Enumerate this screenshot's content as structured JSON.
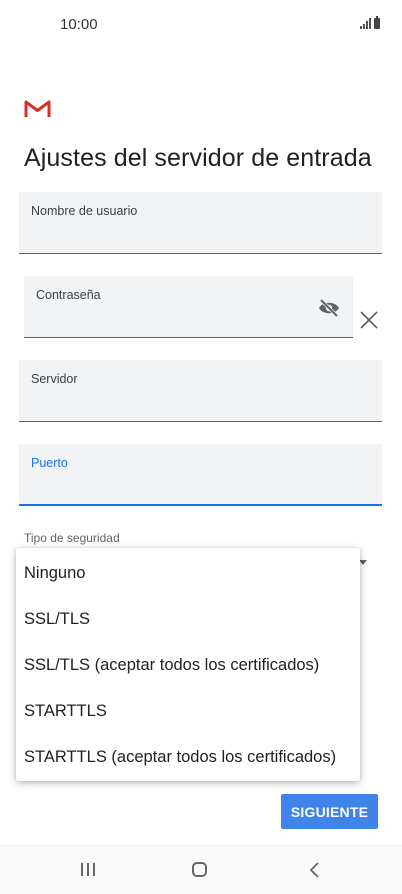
{
  "status_bar": {
    "time": "10:00",
    "icons": [
      "signal-icon",
      "battery-icon"
    ]
  },
  "header": {
    "logo": "gmail-logo",
    "title": "Ajustes del servidor de entrada"
  },
  "form": {
    "username": {
      "label": "Nombre de usuario",
      "value": ""
    },
    "password": {
      "label": "Contraseña",
      "value": "",
      "visibility_icon": "eye-off-icon",
      "clear_icon": "close-icon"
    },
    "server": {
      "label": "Servidor",
      "value": ""
    },
    "port": {
      "label": "Puerto",
      "value": "",
      "focused": true
    },
    "security": {
      "label": "Tipo de seguridad",
      "icon": "dropdown-arrow-icon"
    }
  },
  "security_menu": {
    "options": [
      "Ninguno",
      "SSL/TLS",
      "SSL/TLS (aceptar todos los certificados)",
      "STARTTLS",
      "STARTTLS (aceptar todos los certificados)"
    ]
  },
  "actions": {
    "next_label": "SIGUIENTE"
  },
  "nav_bar": {
    "icons": [
      "recent-apps-icon",
      "home-icon",
      "back-icon"
    ]
  },
  "colors": {
    "accent": "#1a73e8",
    "button": "#3f84e8",
    "gmail_red": "#d93025",
    "field_bg": "#f1f3f4"
  }
}
